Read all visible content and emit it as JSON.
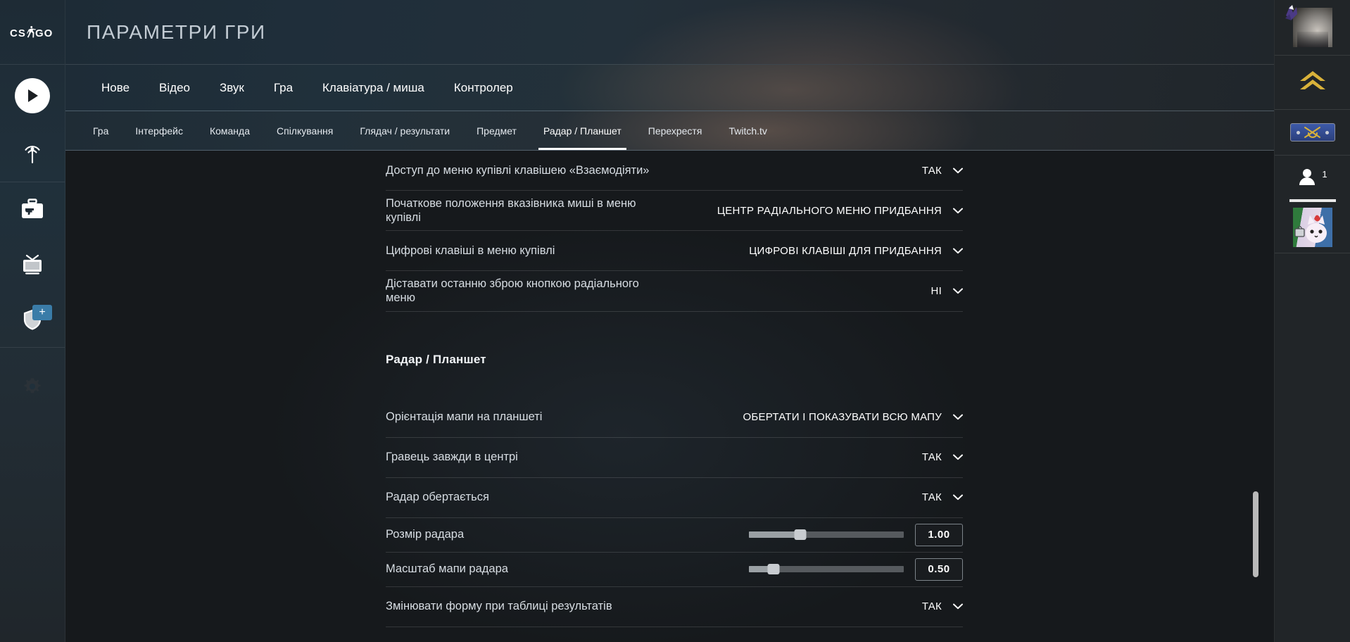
{
  "brand": {
    "logo_text": "CS:GO"
  },
  "header": {
    "title": "ПАРАМЕТРИ ГРИ"
  },
  "left_rail": {
    "items": [
      {
        "name": "play-button",
        "icon": "play-icon"
      },
      {
        "name": "broadcast-button",
        "icon": "broadcast-antenna-icon"
      },
      {
        "name": "inventory-button",
        "icon": "weapon-case-icon"
      },
      {
        "name": "watch-button",
        "icon": "tv-icon"
      },
      {
        "name": "shield-button",
        "icon": "shield-icon",
        "badge": "+"
      },
      {
        "name": "settings-button",
        "icon": "gear-icon"
      }
    ]
  },
  "right_rail": {
    "friends_count": "1"
  },
  "top_nav": {
    "items": [
      {
        "label": "Нове",
        "active": false
      },
      {
        "label": "Відео",
        "active": false
      },
      {
        "label": "Звук",
        "active": false
      },
      {
        "label": "Гра",
        "active": false
      },
      {
        "label": "Клавіатура / миша",
        "active": false
      },
      {
        "label": "Контролер",
        "active": false
      }
    ]
  },
  "sub_nav": {
    "items": [
      {
        "label": "Гра",
        "active": false
      },
      {
        "label": "Інтерфейс",
        "active": false
      },
      {
        "label": "Команда",
        "active": false
      },
      {
        "label": "Спілкування",
        "active": false
      },
      {
        "label": "Глядач / результати",
        "active": false
      },
      {
        "label": "Предмет",
        "active": false
      },
      {
        "label": "Радар / Планшет",
        "active": true
      },
      {
        "label": "Перехрестя",
        "active": false
      },
      {
        "label": "Twitch.tv",
        "active": false
      }
    ]
  },
  "settings": {
    "rows_top": [
      {
        "label": "Доступ до меню купівлі клавішею «Взаємодіяти»",
        "value": "ТАК",
        "control": "dropdown"
      },
      {
        "label": "Початкове положення вказівника миші в меню купівлі",
        "value": "ЦЕНТР РАДІАЛЬНОГО МЕНЮ ПРИДБАННЯ",
        "control": "dropdown"
      },
      {
        "label": "Цифрові клавіші в меню купівлі",
        "value": "ЦИФРОВІ КЛАВІШІ ДЛЯ ПРИДБАННЯ",
        "control": "dropdown"
      },
      {
        "label": "Діставати останню зброю кнопкою радіального меню",
        "value": "НІ",
        "control": "dropdown"
      }
    ],
    "section_title": "Радар / Планшет",
    "rows_radar": [
      {
        "label": "Орієнтація мапи на планшеті",
        "value": "ОБЕРТАТИ І ПОКАЗУВАТИ ВСЮ МАПУ",
        "control": "dropdown"
      },
      {
        "label": "Гравець завжди в центрі",
        "value": "ТАК",
        "control": "dropdown"
      },
      {
        "label": "Радар обертається",
        "value": "ТАК",
        "control": "dropdown"
      },
      {
        "label": "Розмір радара",
        "value": "1.00",
        "control": "slider",
        "slider_percent": 33
      },
      {
        "label": "Масштаб мапи радара",
        "value": "0.50",
        "control": "slider",
        "slider_percent": 16
      },
      {
        "label": "Змінювати форму при таблиці результатів",
        "value": "ТАК",
        "control": "dropdown"
      }
    ]
  },
  "scrollbar": {
    "position": "lower-middle"
  },
  "colors": {
    "accent_blue": "#3a7ca8",
    "rank_gold": "#d9b23a",
    "panel_dark": "#16191c",
    "header_blue": "#1f2e3a",
    "text_primary": "#ffffff",
    "text_muted": "#d7dde3"
  }
}
